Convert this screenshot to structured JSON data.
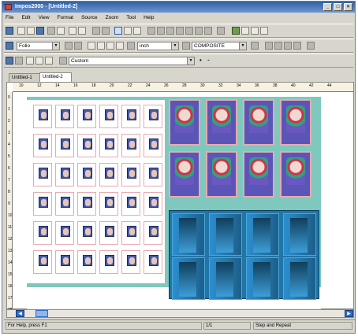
{
  "window": {
    "title": "Impos2000 - [Untitled-2]",
    "controls": [
      "_",
      "□",
      "×"
    ]
  },
  "menu": [
    "File",
    "Edit",
    "View",
    "Format",
    "Source",
    "Zoom",
    "Tool",
    "Help"
  ],
  "toolbar2": {
    "layout_select": "Folio",
    "unit_select": "inch",
    "color_select": "COMPOSITE"
  },
  "toolbar3": {
    "scheme_select": "Custom",
    "bullet": "•",
    "dash": "-"
  },
  "tabs": [
    "Untitled-1",
    "Untitled-2"
  ],
  "ruler": {
    "h_labels": [
      "10",
      "12",
      "14",
      "16",
      "18",
      "20",
      "22",
      "24",
      "26",
      "28",
      "30",
      "32",
      "34",
      "36",
      "38",
      "40",
      "42",
      "44"
    ],
    "v_labels": [
      "0",
      "1",
      "2",
      "3",
      "4",
      "5",
      "6",
      "7",
      "8",
      "9",
      "10",
      "11",
      "12",
      "13",
      "14",
      "15",
      "16",
      "17",
      "18"
    ]
  },
  "status": {
    "help": "For Help, press F1",
    "page": "1/1",
    "mode": "Step and Repeat"
  },
  "icons": [
    "app-icon",
    "new-file-icon",
    "open-folder-icon",
    "save-icon",
    "print-icon",
    "hand-icon",
    "zoom-icon",
    "arrow-icon",
    "scroll-left-icon",
    "scroll-right-icon"
  ],
  "colors": {
    "title_bar": "#2f5fa5",
    "workspace_background": "#7fc8bd",
    "cover_purple": "#5b55b7",
    "photo_blue": "#1f76a7"
  }
}
